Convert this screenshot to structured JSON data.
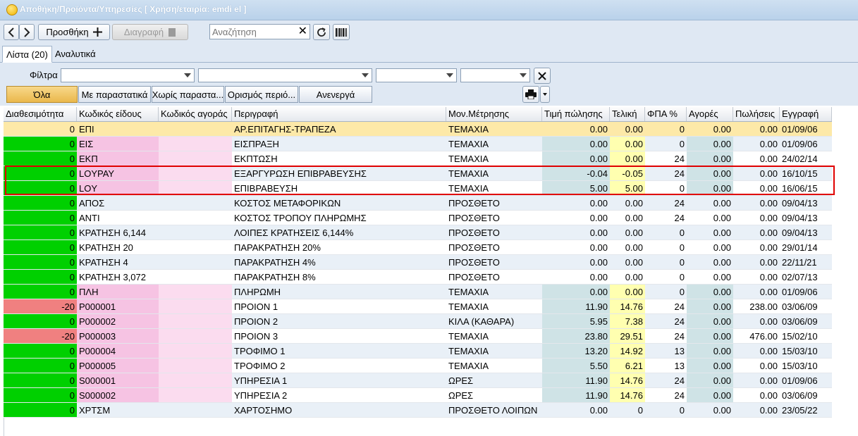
{
  "window": {
    "title": "Αποθήκη/Προϊόντα/Υπηρεσίες   [ Χρήση/εταιρία: emdi el ]"
  },
  "toolbar": {
    "back_icon": "chevron-left-icon",
    "forward_icon": "chevron-right-icon",
    "add_label": "Προσθήκη",
    "delete_label": "Διαγραφή",
    "search_placeholder": "Αναζήτηση",
    "search_value": ""
  },
  "tabs": [
    {
      "label": "Λίστα (20)",
      "active": true
    },
    {
      "label": "Αναλυτικά",
      "active": false
    }
  ],
  "filters": {
    "label": "Φίλτρα",
    "combos": [
      "",
      "",
      "",
      ""
    ],
    "quick_buttons": [
      "Όλα",
      "Με παραστατικά",
      "Χωρίς παραστα...",
      "Ορισμός περιό...",
      "Ανενεργά"
    ]
  },
  "colors": {
    "green": "#00d000",
    "red": "#f08080",
    "pink": "#f6c3e3",
    "lightpink": "#fbdcef",
    "selected": "#fde9a8",
    "teal": "#cfe3e6",
    "yellow": "#ffffb0",
    "stripe": "#e9f0f7",
    "highlight_box": "#e00000"
  },
  "grid": {
    "columns": [
      "Διαθεσιμότητα",
      "Κωδικός είδους",
      "Κωδικός αγοράς",
      "Περιγραφή",
      "Μον.Μέτρησης",
      "Τιμή πώλησης",
      "Τελική",
      "ΦΠΑ %",
      "Αγορές",
      "Πωλήσεις",
      "Εγγραφή"
    ],
    "rows": [
      {
        "avail": "0",
        "code": "ΕΠΙ",
        "buycode": "",
        "desc": "ΑΡ.ΕΠΙΤΑΓΗΣ-ΤΡΑΠΕΖΑ",
        "unit": "ΤΕΜΑΧΙΑ",
        "price": "0.00",
        "final": "0.00",
        "vat": "0",
        "purchases": "0.00",
        "sales": "0.00",
        "date": "01/09/06",
        "avail_color": "selected",
        "selected": true
      },
      {
        "avail": "0",
        "code": "ΕΙΣ",
        "buycode": "",
        "desc": "ΕΙΣΠΡΑΞΗ",
        "unit": "ΤΕΜΑΧΙΑ",
        "price": "0.00",
        "final": "0.00",
        "vat": "0",
        "purchases": "0.00",
        "sales": "0.00",
        "date": "01/09/06",
        "avail_color": "green",
        "style": "pink"
      },
      {
        "avail": "0",
        "code": "ΕΚΠ",
        "buycode": "",
        "desc": "ΕΚΠΤΩΣΗ",
        "unit": "ΤΕΜΑΧΙΑ",
        "price": "0.00",
        "final": "0.00",
        "vat": "24",
        "purchases": "0.00",
        "sales": "0.00",
        "date": "24/02/14",
        "avail_color": "green",
        "style": "pink"
      },
      {
        "avail": "0",
        "code": "LOYPAY",
        "buycode": "",
        "desc": "ΕΞΑΡΓΥΡΩΣΗ ΕΠΙΒΡΑΒΕΥΣΗΣ",
        "unit": "ΤΕΜΑΧΙΑ",
        "price": "-0.04",
        "final": "-0.05",
        "vat": "24",
        "purchases": "0.00",
        "sales": "0.00",
        "date": "16/10/15",
        "avail_color": "green",
        "style": "pink"
      },
      {
        "avail": "0",
        "code": "LOY",
        "buycode": "",
        "desc": "ΕΠΙΒΡΑΒΕΥΣΗ",
        "unit": "ΤΕΜΑΧΙΑ",
        "price": "5.00",
        "final": "5.00",
        "vat": "0",
        "purchases": "0.00",
        "sales": "0.00",
        "date": "16/06/15",
        "avail_color": "green",
        "style": "pink"
      },
      {
        "avail": "0",
        "code": "ΑΠΟΣ",
        "buycode": "",
        "desc": "ΚΟΣΤΟΣ ΜΕΤΑΦΟΡΙΚΩΝ",
        "unit": "ΠΡΟΣΘΕΤΟ",
        "price": "0.00",
        "final": "0.00",
        "vat": "24",
        "purchases": "0.00",
        "sales": "0.00",
        "date": "09/04/13",
        "avail_color": "green",
        "style": "plain"
      },
      {
        "avail": "0",
        "code": "ΑΝΤΙ",
        "buycode": "",
        "desc": "ΚΟΣΤΟΣ ΤΡΟΠΟΥ ΠΛΗΡΩΜΗΣ",
        "unit": "ΠΡΟΣΘΕΤΟ",
        "price": "0.00",
        "final": "0.00",
        "vat": "24",
        "purchases": "0.00",
        "sales": "0.00",
        "date": "09/04/13",
        "avail_color": "green",
        "style": "plain"
      },
      {
        "avail": "0",
        "code": "ΚΡΑΤΗΣΗ 6,144",
        "buycode": "",
        "desc": "ΛΟΙΠΕΣ ΚΡΑΤΗΣΕΙΣ 6,144%",
        "unit": "ΠΡΟΣΘΕΤΟ",
        "price": "0.00",
        "final": "0.00",
        "vat": "0",
        "purchases": "0.00",
        "sales": "0.00",
        "date": "09/04/13",
        "avail_color": "green",
        "style": "plain"
      },
      {
        "avail": "0",
        "code": "ΚΡΑΤΗΣΗ 20",
        "buycode": "",
        "desc": "ΠΑΡΑΚΡΑΤΗΣΗ 20%",
        "unit": "ΠΡΟΣΘΕΤΟ",
        "price": "0.00",
        "final": "0.00",
        "vat": "0",
        "purchases": "0.00",
        "sales": "0.00",
        "date": "29/01/14",
        "avail_color": "green",
        "style": "plain"
      },
      {
        "avail": "0",
        "code": "ΚΡΑΤΗΣΗ 4",
        "buycode": "",
        "desc": "ΠΑΡΑΚΡΑΤΗΣΗ 4%",
        "unit": "ΠΡΟΣΘΕΤΟ",
        "price": "0.00",
        "final": "0.00",
        "vat": "0",
        "purchases": "0.00",
        "sales": "0.00",
        "date": "22/11/21",
        "avail_color": "green",
        "style": "plain"
      },
      {
        "avail": "0",
        "code": "ΚΡΑΤΗΣΗ 3,072",
        "buycode": "",
        "desc": "ΠΑΡΑΚΡΑΤΗΣΗ 8%",
        "unit": "ΠΡΟΣΘΕΤΟ",
        "price": "0.00",
        "final": "0.00",
        "vat": "0",
        "purchases": "0.00",
        "sales": "0.00",
        "date": "02/07/13",
        "avail_color": "green",
        "style": "plain"
      },
      {
        "avail": "0",
        "code": "ΠΛΗ",
        "buycode": "",
        "desc": "ΠΛΗΡΩΜΗ",
        "unit": "ΤΕΜΑΧΙΑ",
        "price": "0.00",
        "final": "0.00",
        "vat": "0",
        "purchases": "0.00",
        "sales": "0.00",
        "date": "01/09/06",
        "avail_color": "green",
        "style": "pink"
      },
      {
        "avail": "-20",
        "code": "P000001",
        "buycode": "",
        "desc": "ΠΡΟΙΟΝ 1",
        "unit": "ΤΕΜΑΧΙΑ",
        "price": "11.90",
        "final": "14.76",
        "vat": "24",
        "purchases": "0.00",
        "sales": "238.00",
        "date": "03/06/09",
        "avail_color": "red",
        "style": "pink"
      },
      {
        "avail": "0",
        "code": "P000002",
        "buycode": "",
        "desc": "ΠΡΟΙΟΝ 2",
        "unit": "ΚΙΛΑ (ΚΑΘΑΡΑ)",
        "price": "5.95",
        "final": "7.38",
        "vat": "24",
        "purchases": "0.00",
        "sales": "0.00",
        "date": "03/06/09",
        "avail_color": "green",
        "style": "pink"
      },
      {
        "avail": "-20",
        "code": "P000003",
        "buycode": "",
        "desc": "ΠΡΟΙΟΝ 3",
        "unit": "ΤΕΜΑΧΙΑ",
        "price": "23.80",
        "final": "29.51",
        "vat": "24",
        "purchases": "0.00",
        "sales": "476.00",
        "date": "15/02/10",
        "avail_color": "red",
        "style": "pink"
      },
      {
        "avail": "0",
        "code": "P000004",
        "buycode": "",
        "desc": "ΤΡΟΦΙΜΟ 1",
        "unit": "ΤΕΜΑΧΙΑ",
        "price": "13.20",
        "final": "14.92",
        "vat": "13",
        "purchases": "0.00",
        "sales": "0.00",
        "date": "15/03/10",
        "avail_color": "green",
        "style": "pink"
      },
      {
        "avail": "0",
        "code": "P000005",
        "buycode": "",
        "desc": "ΤΡΟΦΙΜΟ 2",
        "unit": "ΤΕΜΑΧΙΑ",
        "price": "5.50",
        "final": "6.21",
        "vat": "13",
        "purchases": "0.00",
        "sales": "0.00",
        "date": "15/03/10",
        "avail_color": "green",
        "style": "pink"
      },
      {
        "avail": "0",
        "code": "S000001",
        "buycode": "",
        "desc": "ΥΠΗΡΕΣΙΑ 1",
        "unit": "ΩΡΕΣ",
        "price": "11.90",
        "final": "14.76",
        "vat": "24",
        "purchases": "0.00",
        "sales": "0.00",
        "date": "01/09/06",
        "avail_color": "green",
        "style": "pink"
      },
      {
        "avail": "0",
        "code": "S000002",
        "buycode": "",
        "desc": "ΥΠΗΡΕΣΙΑ 2",
        "unit": "ΩΡΕΣ",
        "price": "11.90",
        "final": "14.76",
        "vat": "24",
        "purchases": "0.00",
        "sales": "0.00",
        "date": "03/06/09",
        "avail_color": "green",
        "style": "pink"
      },
      {
        "avail": "0",
        "code": "ΧΡΤΣΜ",
        "buycode": "",
        "desc": "ΧΑΡΤΟΣΗΜΟ",
        "unit": "ΠΡΟΣΘΕΤΟ ΛΟΙΠΩΝ",
        "price": "0.00",
        "final": "0",
        "vat": "0",
        "purchases": "0.00",
        "sales": "0.00",
        "date": "23/05/22",
        "avail_color": "green",
        "style": "plain"
      }
    ]
  }
}
